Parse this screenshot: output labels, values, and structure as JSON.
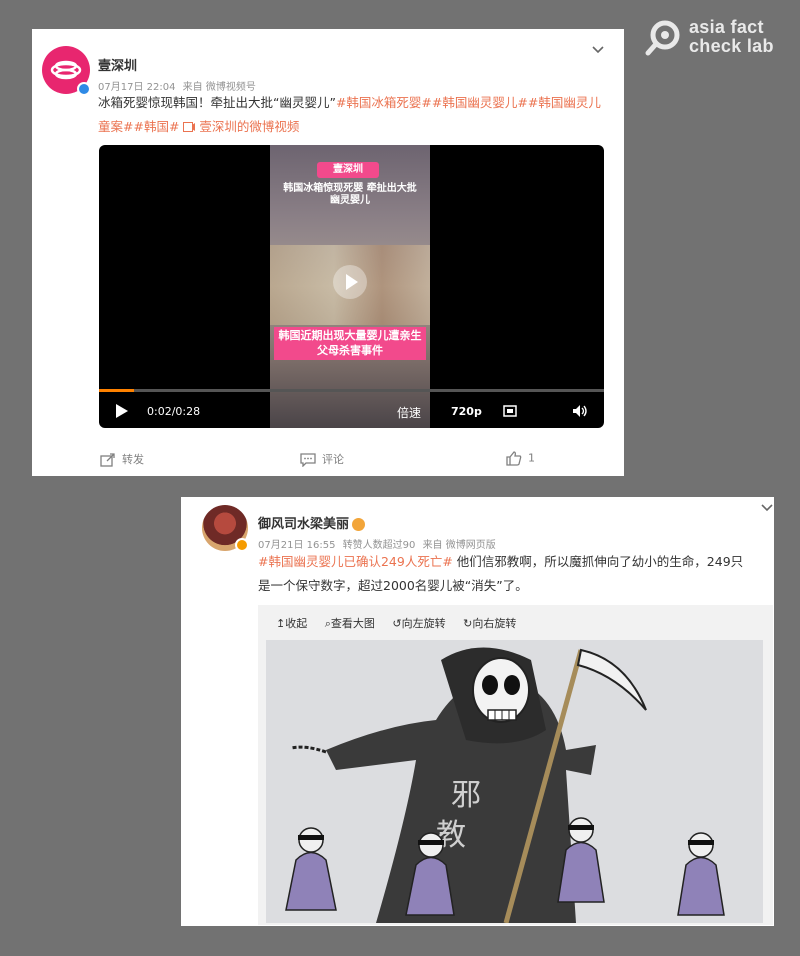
{
  "watermark": {
    "line1": "asia fact",
    "line2": "check lab"
  },
  "post1": {
    "username": "壹深圳",
    "date": "07月17日 22:04",
    "source": "来自 微博视频号",
    "text_plain": "冰箱死婴惊现韩国！牵扯出大批“幽灵婴儿”",
    "tags_line1": "#韩国冰箱死婴##韩国幽灵婴儿##韩国幽灵儿",
    "tags_line2": "童案##韩国#",
    "video_link": " 壹深圳的微博视频",
    "video": {
      "logo_text": "壹深圳",
      "caption_top": "韩国冰箱惊现死婴 牵扯出大批幽灵婴儿",
      "caption_bottom": "韩国近期出现大量婴儿遭亲生父母杀害事件",
      "time": "0:02/0:28",
      "speed_label": "倍速",
      "quality_label": "720p",
      "progress": 0.07
    },
    "actions": {
      "repost": "转发",
      "comment": "评论",
      "like_count": "1"
    }
  },
  "post2": {
    "username": "御风司水梁美丽",
    "date": "07月21日 16:55",
    "reposts_info": "转赞人数超过90",
    "source": "来自 微博网页版",
    "tag": "#韩国幽灵婴儿已确认249人死亡#",
    "text_line1": " 他们信邪教啊，所以魔抓伸向了幼小的生命，249只",
    "text_line2": "是一个保守数字，超过2000名婴儿被“消失”了。",
    "toolbar": {
      "collapse": "收起",
      "view_large": "查看大图",
      "rotate_left": "向左旋转",
      "rotate_right": "向右旋转"
    },
    "cartoon_text": {
      "char1": "邪",
      "char2": "教"
    }
  },
  "colors": {
    "accent": "#eb7350",
    "verified_blue": "#2e8ae6",
    "brand_pink": "#f24a8c",
    "progress_orange": "#ff8200"
  }
}
